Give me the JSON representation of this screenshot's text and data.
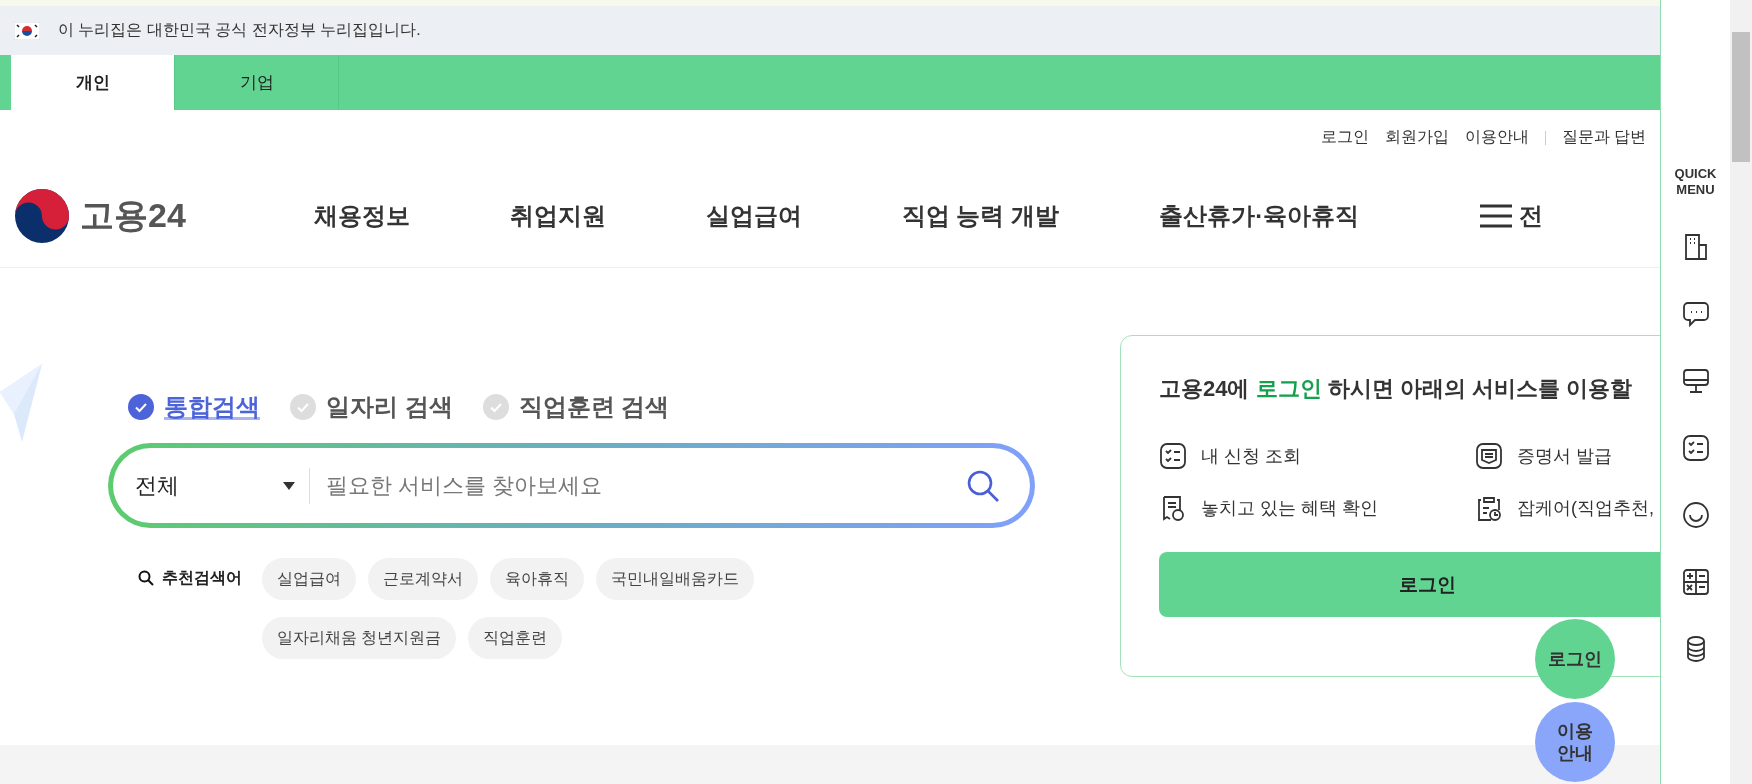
{
  "gov_banner": {
    "text": "이 누리집은 대한민국 공식 전자정부 누리집입니다."
  },
  "audience_tabs": [
    {
      "label": "개인",
      "selected": true
    },
    {
      "label": "기업",
      "selected": false
    }
  ],
  "utility_links": [
    "로그인",
    "회원가입",
    "이용안내",
    "질문과 답변"
  ],
  "logo": {
    "text": "고용24"
  },
  "nav": [
    "채용정보",
    "취업지원",
    "실업급여",
    "직업 능력 개발",
    "출산휴가·육아휴직"
  ],
  "all_menu": {
    "label": "전"
  },
  "search": {
    "types": [
      {
        "label": "통합검색",
        "selected": true
      },
      {
        "label": "일자리 검색",
        "selected": false
      },
      {
        "label": "직업훈련 검색",
        "selected": false
      }
    ],
    "category": "전체",
    "placeholder": "필요한 서비스를 찾아보세요",
    "recommend_label": "추천검색어",
    "keywords": [
      "실업급여",
      "근로계약서",
      "육아휴직",
      "국민내일배움카드",
      "일자리채움 청년지원금",
      "직업훈련"
    ]
  },
  "login_panel": {
    "title_lead": "고용24에 ",
    "title_highlight": "로그인",
    "title_rest": " 하시면 아래의 서비스를 이용할",
    "services": [
      {
        "label": "내 신청 조회",
        "kind": "list"
      },
      {
        "label": "증명서 발급",
        "kind": "certificate"
      },
      {
        "label": "놓치고 있는 혜택 확인",
        "kind": "receipt"
      },
      {
        "label": "잡케어(직업추천,",
        "kind": "clipboard"
      }
    ],
    "button": "로그인"
  },
  "quick_menu": {
    "title_lines": [
      "QUICK",
      "MENU"
    ],
    "items": [
      {
        "kind": "building"
      },
      {
        "kind": "chat"
      },
      {
        "kind": "monitor"
      },
      {
        "kind": "checklist"
      },
      {
        "kind": "smile"
      },
      {
        "kind": "calculator"
      },
      {
        "kind": "coins"
      }
    ]
  },
  "floating": [
    {
      "label": "로그인",
      "kind": "login"
    },
    {
      "label": "이용안내",
      "kind": "guide"
    }
  ]
}
